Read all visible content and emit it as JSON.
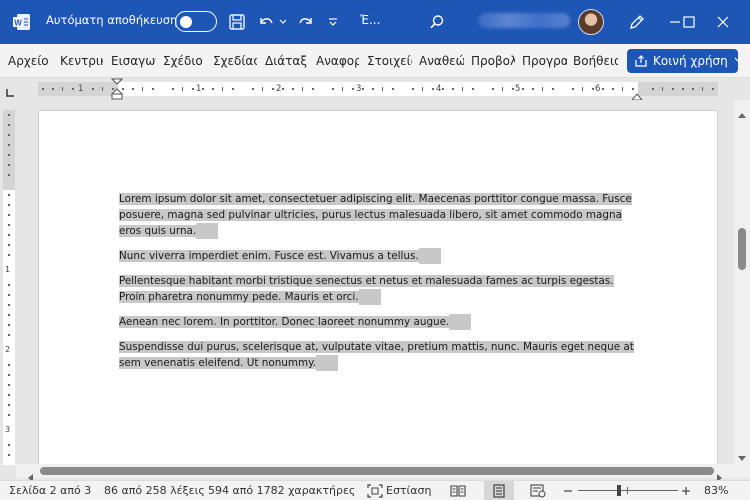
{
  "titlebar": {
    "autosave_label": "Αυτόματη αποθήκευση",
    "doc_title": "Έ..."
  },
  "ribbon": {
    "tabs": [
      {
        "label": "Αρχείο"
      },
      {
        "label": "Κεντρική"
      },
      {
        "label": "Εισαγωγή"
      },
      {
        "label": "Σχέδιο"
      },
      {
        "label": "Σχεδίαση"
      },
      {
        "label": "Διάταξη"
      },
      {
        "label": "Αναφορές"
      },
      {
        "label": "Στοιχεία"
      },
      {
        "label": "Αναθεώρηση"
      },
      {
        "label": "Προβολή"
      },
      {
        "label": "Προγραμματιστής"
      },
      {
        "label": "Βοήθεια"
      }
    ],
    "share_label": "Κοινή χρήση"
  },
  "ruler": {
    "h_numbers": [
      "1",
      "1",
      "2",
      "3",
      "4",
      "5",
      "6"
    ],
    "v_numbers": [
      "1",
      "2",
      "3"
    ]
  },
  "document": {
    "paragraphs": [
      "Lorem ipsum dolor sit amet, consectetuer adipiscing elit. Maecenas porttitor congue massa. Fusce posuere, magna sed pulvinar ultricies, purus lectus malesuada libero, sit amet commodo magna eros quis urna.",
      "Nunc viverra imperdiet enim. Fusce est. Vivamus a tellus.",
      "Pellentesque habitant morbi tristique senectus et netus et malesuada fames ac turpis egestas. Proin pharetra nonummy pede. Mauris et orci.",
      "Aenean nec lorem. In porttitor. Donec laoreet nonummy augue.",
      "Suspendisse dui purus, scelerisque at, vulputate vitae, pretium mattis, nunc. Mauris eget neque at sem venenatis eleifend. Ut nonummy."
    ]
  },
  "status": {
    "page": "Σελίδα 2 από 3",
    "words": "86 από 258 λέξεις",
    "chars": "594 από 1782 χαρακτήρες",
    "focus": "Εστίαση",
    "zoom": "83%"
  },
  "colors": {
    "brand_blue": "#1e56b6",
    "selection": "#c8c8c8"
  }
}
